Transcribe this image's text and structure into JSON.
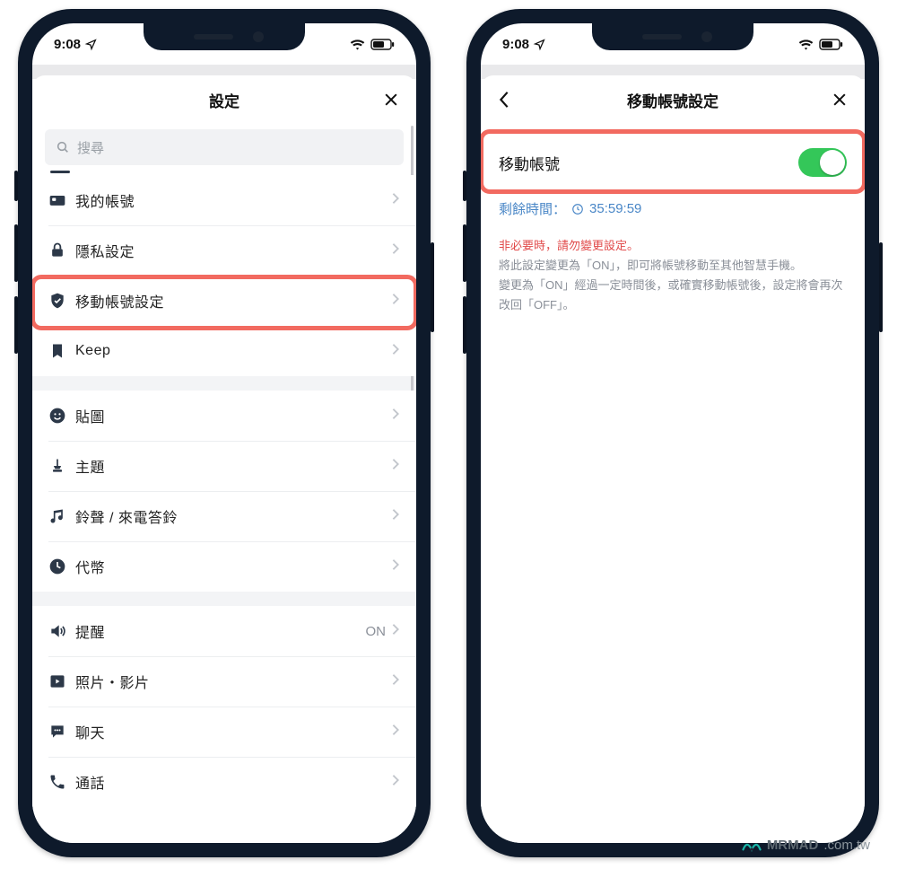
{
  "statusbar": {
    "time": "9:08"
  },
  "phone1": {
    "title": "設定",
    "search_placeholder": "搜尋",
    "groups": [
      {
        "items": [
          {
            "id": "account",
            "icon": "id-card-icon",
            "label": "我的帳號"
          },
          {
            "id": "privacy",
            "icon": "lock-icon",
            "label": "隱私設定"
          },
          {
            "id": "transfer",
            "icon": "shield-check-icon",
            "label": "移動帳號設定",
            "highlighted": true
          },
          {
            "id": "keep",
            "icon": "bookmark-icon",
            "label": "Keep"
          }
        ]
      },
      {
        "items": [
          {
            "id": "stickers",
            "icon": "smile-icon",
            "label": "貼圖"
          },
          {
            "id": "themes",
            "icon": "brush-icon",
            "label": "主題"
          },
          {
            "id": "ringtone",
            "icon": "music-note-icon",
            "label": "鈴聲 / 來電答鈴"
          },
          {
            "id": "coins",
            "icon": "clock-icon",
            "label": "代幣"
          }
        ]
      },
      {
        "items": [
          {
            "id": "notify",
            "icon": "speaker-icon",
            "label": "提醒",
            "value": "ON"
          },
          {
            "id": "media",
            "icon": "play-icon",
            "label": "照片・影片"
          },
          {
            "id": "chat",
            "icon": "chat-icon",
            "label": "聊天"
          },
          {
            "id": "call",
            "icon": "phone-icon",
            "label": "通話"
          }
        ]
      }
    ]
  },
  "phone2": {
    "title": "移動帳號設定",
    "toggle_label": "移動帳號",
    "toggle_on": true,
    "time_label": "剩餘時間：",
    "time_value": "35:59:59",
    "warn": "非必要時，請勿變更設定。",
    "note_l1": "將此設定變更為「ON」，即可將帳號移動至其他智慧手機。",
    "note_l2": "變更為「ON」經過一定時間後，或確實移動帳號後，設定將會再次改回「OFF」。"
  },
  "watermark": {
    "brand": "MRMAD",
    "domain": ".com.tw"
  }
}
